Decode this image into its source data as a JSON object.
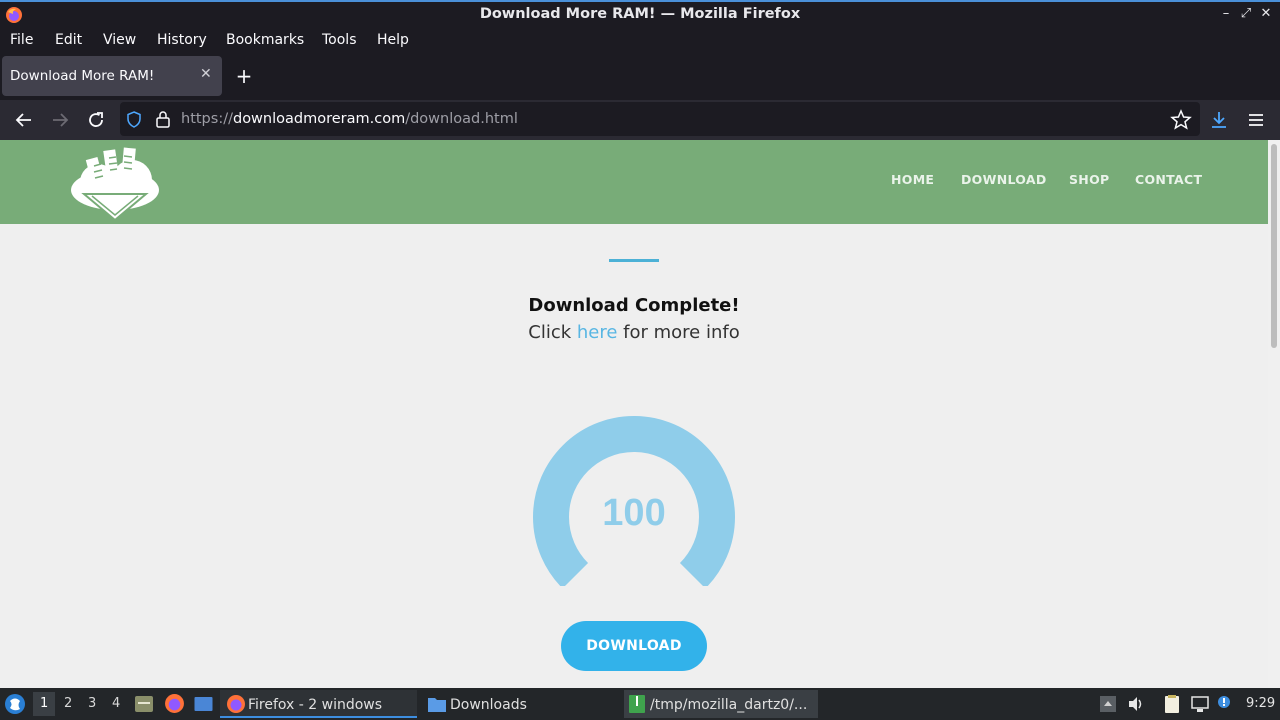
{
  "window": {
    "title": "Download More RAM! — Mozilla Firefox"
  },
  "menu": [
    "File",
    "Edit",
    "View",
    "History",
    "Bookmarks",
    "Tools",
    "Help"
  ],
  "tab": {
    "label": "Download More RAM!"
  },
  "url": {
    "scheme": "https://",
    "host": "downloadmoreram.com",
    "path": "/download.html"
  },
  "site": {
    "nav": [
      "HOME",
      "DOWNLOAD",
      "SHOP",
      "CONTACT"
    ],
    "heading": "Download Complete!",
    "sub_before": "Click ",
    "sub_link": "here",
    "sub_after": " for more info",
    "gauge_value": "100",
    "gauge_fraction": 1.0,
    "button": "DOWNLOAD",
    "colors": {
      "header": "#78ac78",
      "accent": "#32b2ea",
      "gauge": "#8fcdea"
    }
  },
  "taskbar": {
    "workspaces": [
      "1",
      "2",
      "3",
      "4"
    ],
    "tasks": [
      "Firefox - 2 windows",
      "Downloads",
      "/tmp/mozilla_dartz0/..."
    ],
    "clock": "9:29"
  }
}
